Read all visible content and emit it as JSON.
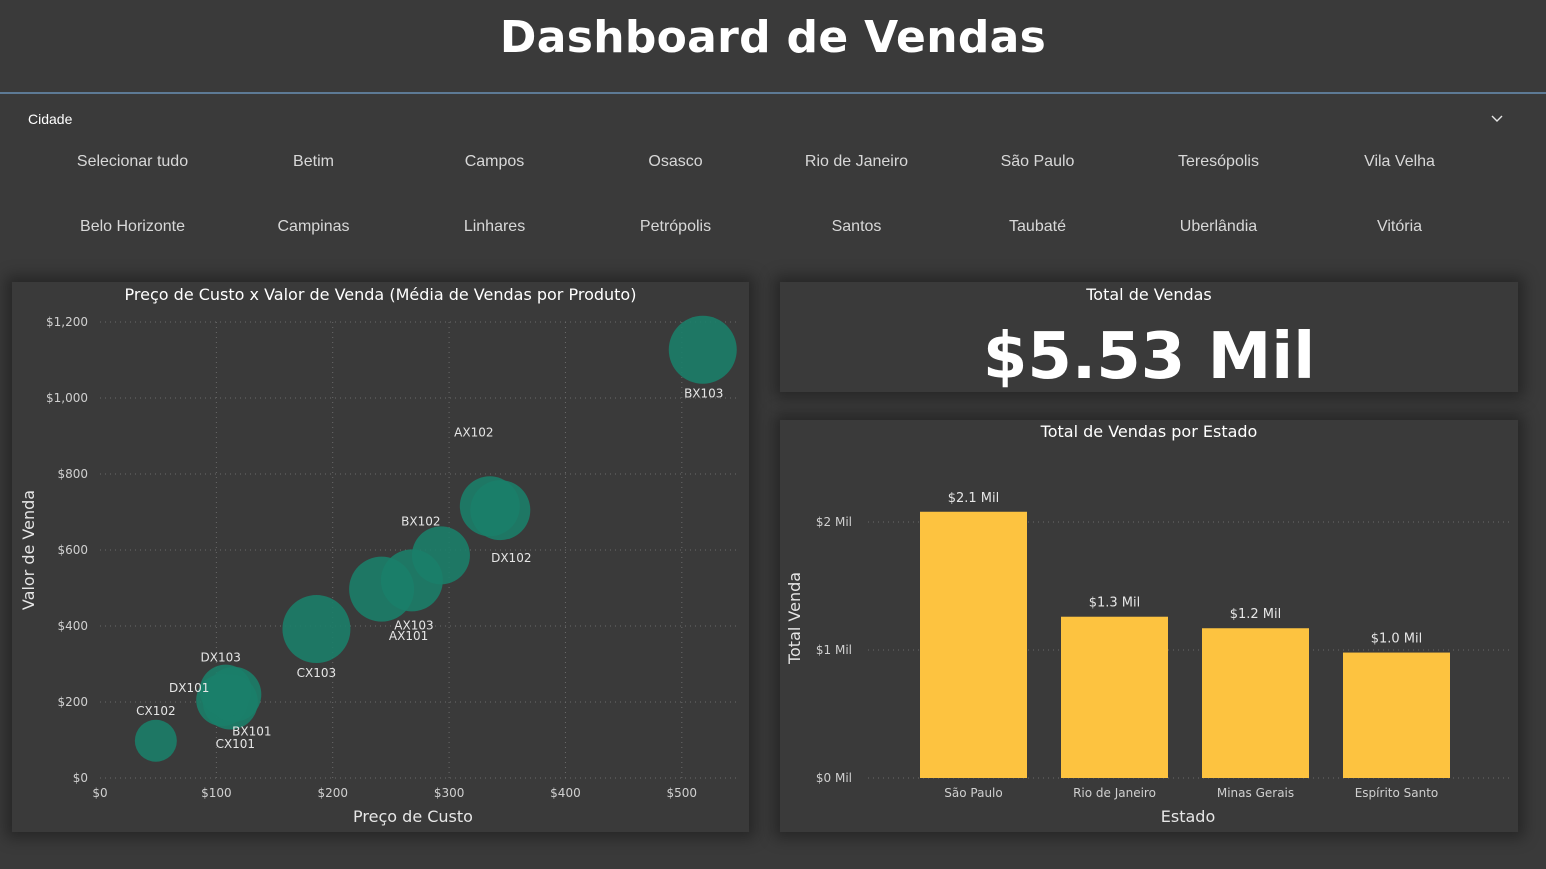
{
  "header": {
    "title": "Dashboard de Vendas"
  },
  "slicer": {
    "title": "Cidade",
    "items": [
      "Selecionar tudo",
      "Betim",
      "Campos",
      "Osasco",
      "Rio de Janeiro",
      "São Paulo",
      "Teresópolis",
      "Vila Velha",
      "Belo Horizonte",
      "Campinas",
      "Linhares",
      "Petrópolis",
      "Santos",
      "Taubaté",
      "Uberlândia",
      "Vitória"
    ]
  },
  "kpi": {
    "title": "Total de Vendas",
    "value": "$5.53 Mil"
  },
  "colors": {
    "scatter": "#1a7f6a",
    "bar": "#fdc340",
    "background": "#3a3a3a"
  },
  "chart_data": [
    {
      "type": "scatter",
      "title": "Preço de Custo x Valor de Venda (Média de Vendas por Produto)",
      "xlabel": "Preço de Custo",
      "ylabel": "Valor de Venda",
      "xlim": [
        0,
        550
      ],
      "ylim": [
        0,
        1200
      ],
      "x_ticks": [
        "$0",
        "$100",
        "$200",
        "$300",
        "$400",
        "$500"
      ],
      "y_ticks": [
        "$0",
        "$200",
        "$400",
        "$600",
        "$800",
        "$1,000",
        "$1,200"
      ],
      "grid": true,
      "points": [
        {
          "label": "CX102",
          "x": 48,
          "y": 98,
          "size": 0.42
        },
        {
          "label": "DX101",
          "x": 105,
          "y": 205,
          "size": 0.52
        },
        {
          "label": "CX101",
          "x": 112,
          "y": 200,
          "size": 0.55
        },
        {
          "label": "BX101",
          "x": 115,
          "y": 220,
          "size": 0.55
        },
        {
          "label": "DX103",
          "x": 108,
          "y": 230,
          "size": 0.52
        },
        {
          "label": "CX103",
          "x": 186,
          "y": 392,
          "size": 0.68
        },
        {
          "label": "AX101",
          "x": 242,
          "y": 497,
          "size": 0.65
        },
        {
          "label": "BX102",
          "x": 268,
          "y": 520,
          "size": 0.62
        },
        {
          "label": "AX103",
          "x": 293,
          "y": 586,
          "size": 0.58
        },
        {
          "label": "AX102",
          "x": 335,
          "y": 715,
          "size": 0.6
        },
        {
          "label": "DX102",
          "x": 344,
          "y": 705,
          "size": 0.6
        },
        {
          "label": "BX103",
          "x": 518,
          "y": 1127,
          "size": 0.68
        }
      ]
    },
    {
      "type": "bar",
      "title": "Total de Vendas por Estado",
      "xlabel": "Estado",
      "ylabel": "Total Venda",
      "categories": [
        "São Paulo",
        "Rio de Janeiro",
        "Minas Gerais",
        "Espírito Santo"
      ],
      "values": [
        2.08,
        1.26,
        1.17,
        0.98
      ],
      "value_labels": [
        "$2.1 Mil",
        "$1.3 Mil",
        "$1.2 Mil",
        "$1.0 Mil"
      ],
      "ylim": [
        0,
        2.5
      ],
      "y_ticks": [
        "$0 Mil",
        "$1 Mil",
        "$2 Mil"
      ],
      "grid": true
    }
  ]
}
